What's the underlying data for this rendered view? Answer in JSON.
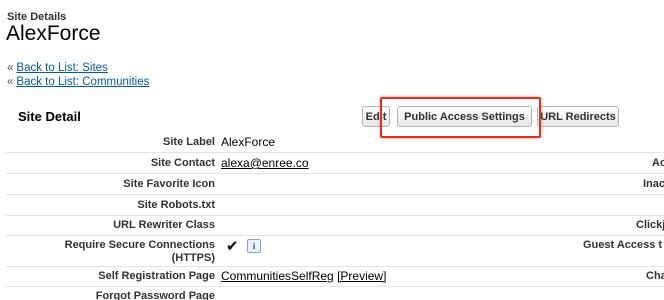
{
  "header": {
    "subtitle": "Site Details",
    "title": "AlexForce"
  },
  "back_links": [
    {
      "arrow": "«",
      "label": "Back to List: Sites"
    },
    {
      "arrow": "«",
      "label": "Back to List: Communities"
    }
  ],
  "section": {
    "title": "Site Detail",
    "buttons": {
      "edit": "Edit",
      "public_access": "Public Access Settings",
      "url_redirects": "URL Redirects"
    }
  },
  "fields": {
    "site_label": {
      "label": "Site Label",
      "value": "AlexForce"
    },
    "site_contact": {
      "label": "Site Contact",
      "value": "alexa@enree.co"
    },
    "site_favorite_icon": {
      "label": "Site Favorite Icon",
      "value": ""
    },
    "site_robots": {
      "label": "Site Robots.txt",
      "value": ""
    },
    "url_rewriter": {
      "label": "URL Rewriter Class",
      "value": ""
    },
    "require_secure": {
      "label_line1": "Require Secure Connections",
      "label_line2": "(HTTPS)",
      "value": "✔",
      "info": "i"
    },
    "self_registration": {
      "label": "Self Registration Page",
      "value": "CommunitiesSelfReg",
      "preview": "[Preview]"
    },
    "forgot_password": {
      "label": "Forgot Password Page",
      "value": ""
    }
  },
  "right_labels": {
    "active": "Ac",
    "inactive": "Inac",
    "clickjack": "Clickj",
    "guest_access": "Guest Access t",
    "change": "Cha"
  }
}
